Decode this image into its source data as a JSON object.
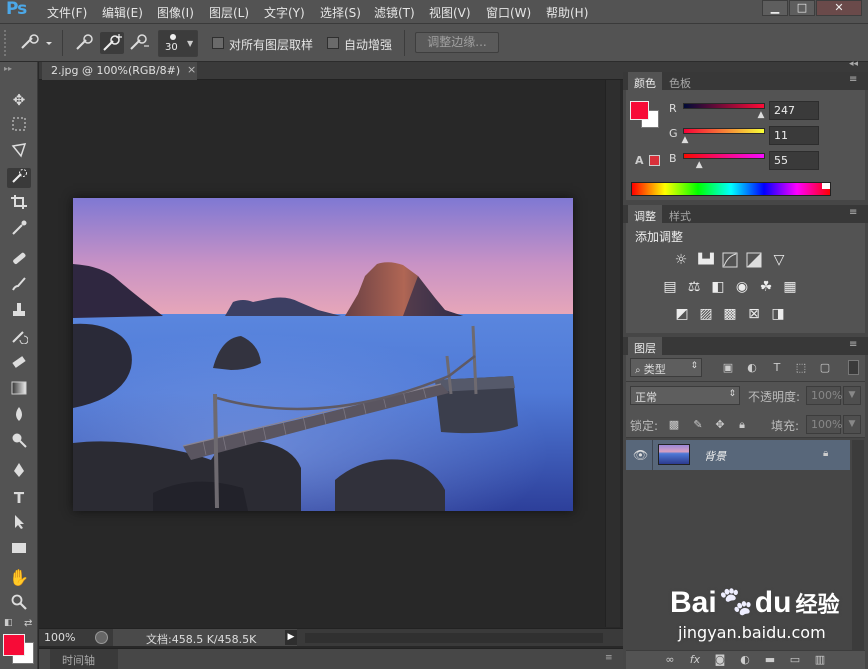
{
  "app": {
    "logo": "Ps"
  },
  "menu": [
    "文件(F)",
    "编辑(E)",
    "图像(I)",
    "图层(L)",
    "文字(Y)",
    "选择(S)",
    "滤镜(T)",
    "视图(V)",
    "窗口(W)",
    "帮助(H)"
  ],
  "window_controls": {
    "minimize": "▁",
    "restore": "□",
    "close": "✕"
  },
  "options": {
    "brush_size": "30",
    "sample_all_layers": "对所有图层取样",
    "auto_enhance": "自动增强",
    "refine_edge": "调整边缘..."
  },
  "document": {
    "tab_title": "2.jpg @ 100%(RGB/8#)",
    "tab_close": "×",
    "zoom": "100%",
    "doc_info": "文档:458.5 K/458.5K",
    "timeline": "时间轴"
  },
  "color_panel": {
    "tabs": [
      "颜色",
      "色板"
    ],
    "channels": [
      {
        "label": "R",
        "value": "247",
        "fraction": 0.969
      },
      {
        "label": "G",
        "value": "11",
        "fraction": 0.043
      },
      {
        "label": "B",
        "value": "55",
        "fraction": 0.216
      }
    ],
    "foreground": "#f70b37",
    "background": "#ffffff"
  },
  "adjust_panel": {
    "tabs": [
      "调整",
      "样式"
    ],
    "heading": "添加调整"
  },
  "layers_panel": {
    "tabs": [
      "图层"
    ],
    "filter_kind": "类型",
    "blend_mode": "正常",
    "opacity_label": "不透明度:",
    "opacity_value": "100%",
    "lock_label": "锁定:",
    "fill_label": "填充:",
    "fill_value": "100%",
    "layers": [
      {
        "name": "背景"
      }
    ]
  },
  "watermark": {
    "brand_a": "Bai",
    "brand_b": "du",
    "brand_c": "经验",
    "url": "jingyan.baidu.com"
  }
}
